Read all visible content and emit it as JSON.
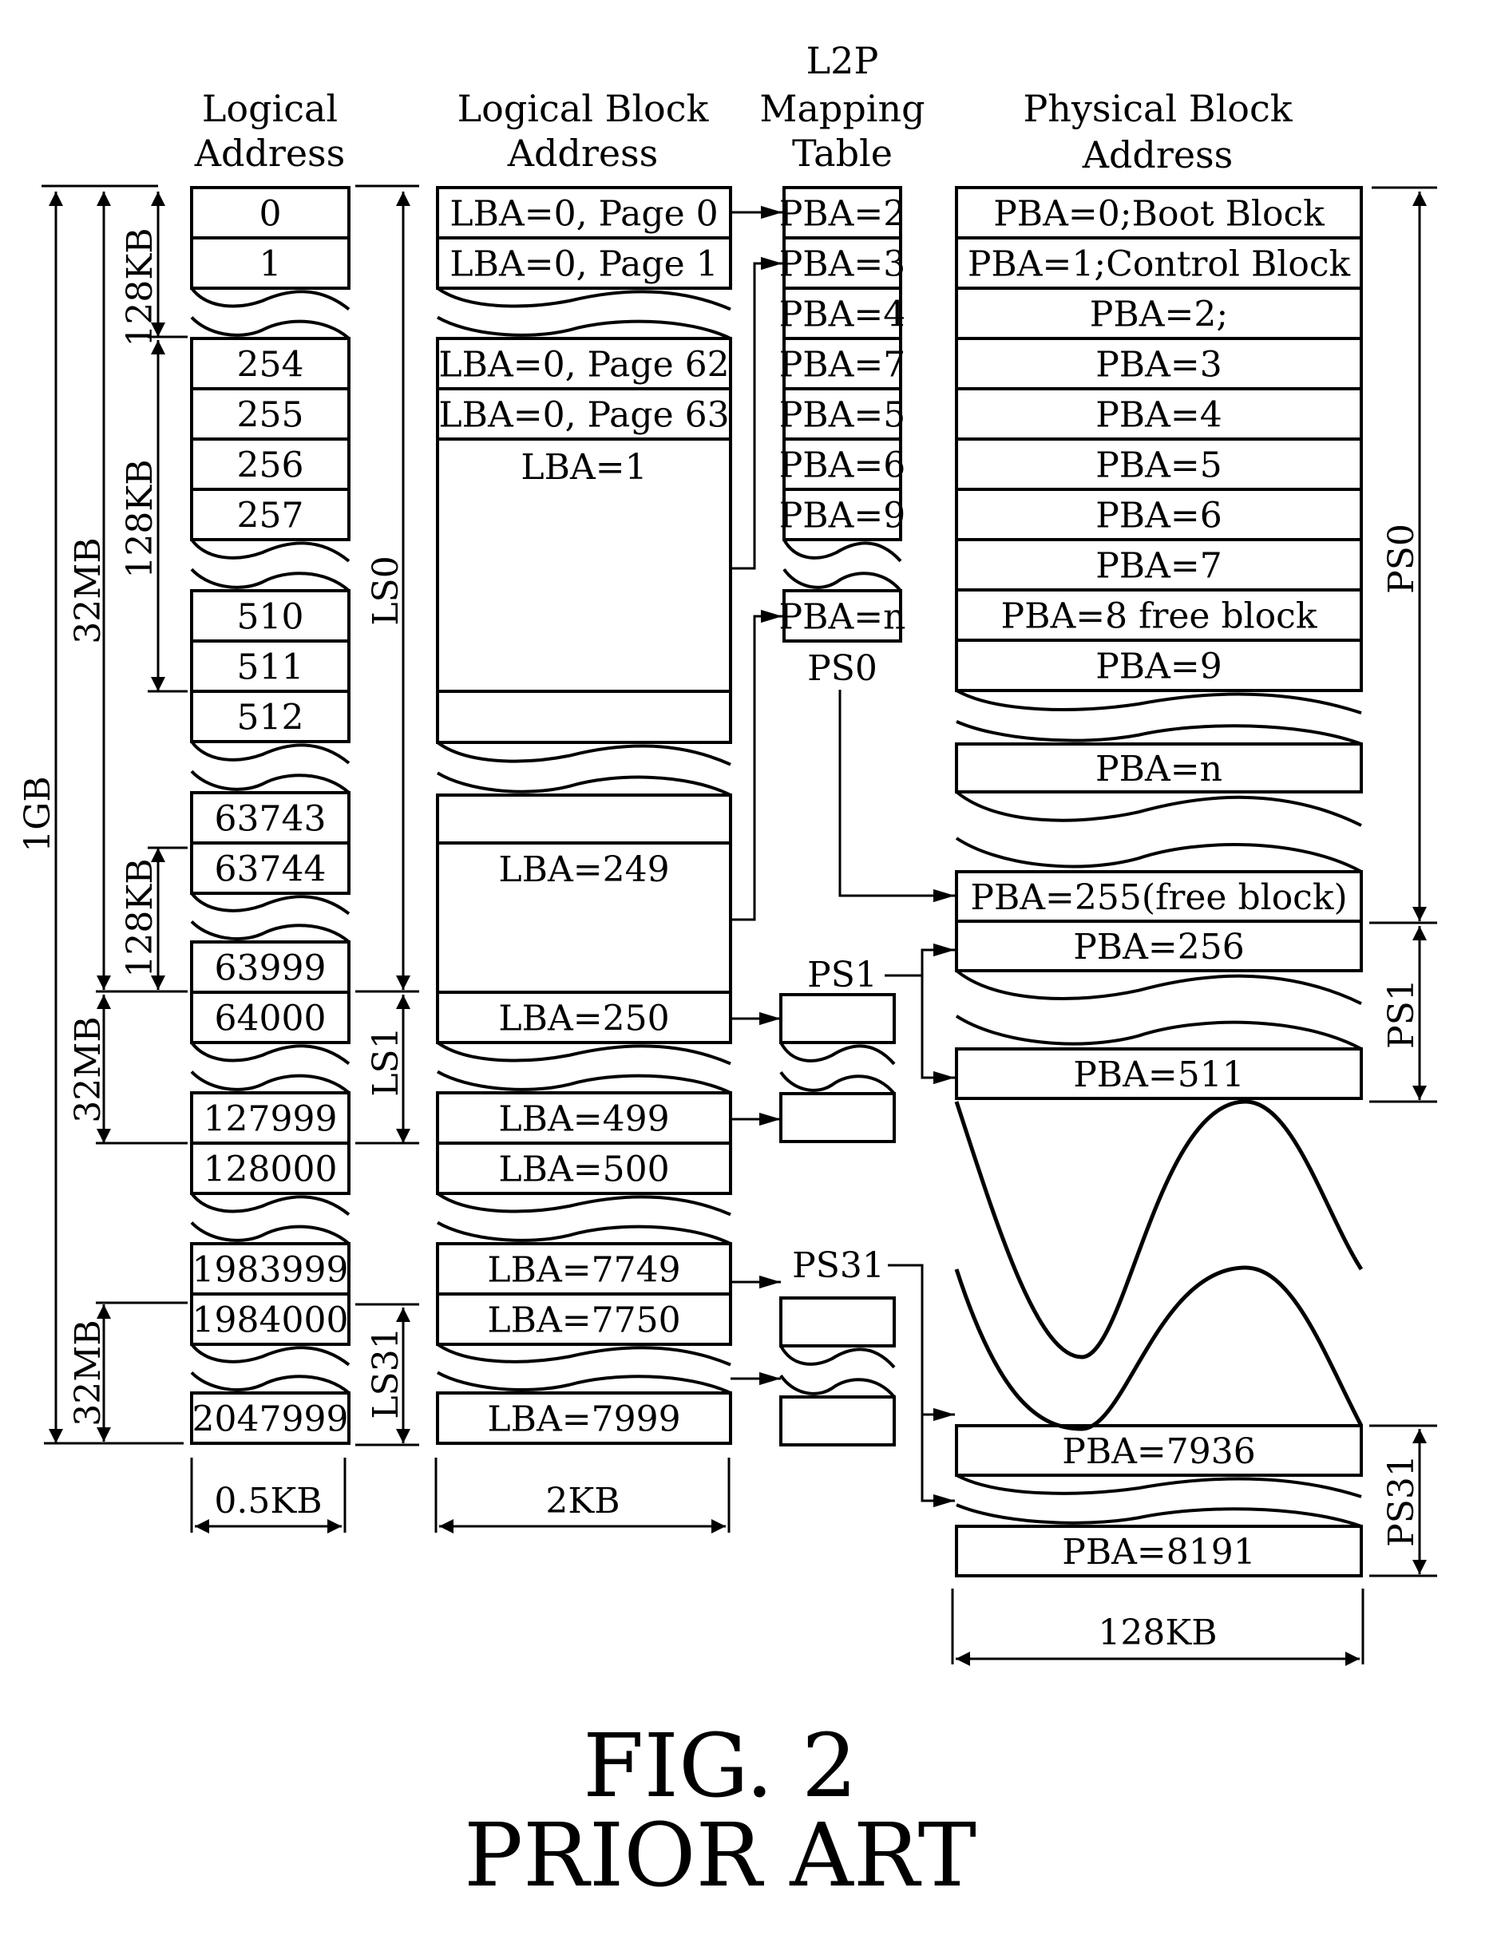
{
  "figure": {
    "title": "FIG. 2",
    "subtitle": "PRIOR ART"
  },
  "headers": {
    "logical_address": [
      "Logical",
      "Address"
    ],
    "logical_block_address": [
      "Logical Block",
      "Address"
    ],
    "l2p_mapping_table": [
      "L2P",
      "Mapping",
      "Table"
    ],
    "physical_block_address": [
      "Physical Block",
      "Address"
    ]
  },
  "logical_address_cells": [
    "0",
    "1",
    "254",
    "255",
    "256",
    "257",
    "510",
    "511",
    "512",
    "63743",
    "63744",
    "63999",
    "64000",
    "127999",
    "128000",
    "1983999",
    "1984000",
    "2047999"
  ],
  "lba_cells": [
    "LBA=0, Page 0",
    "LBA=0, Page 1",
    "LBA=0, Page 62",
    "LBA=0, Page 63",
    "LBA=1",
    "LBA=249",
    "LBA=250",
    "LBA=499",
    "LBA=500",
    "LBA=7749",
    "LBA=7750",
    "LBA=7999"
  ],
  "l2p_cells": [
    "PBA=2",
    "PBA=3",
    "PBA=4",
    "PBA=7",
    "PBA=5",
    "PBA=6",
    "PBA=9",
    "PBA=n"
  ],
  "pba_cells": [
    "PBA=0;Boot Block",
    "PBA=1;Control Block",
    "PBA=2;",
    "PBA=3",
    "PBA=4",
    "PBA=5",
    "PBA=6",
    "PBA=7",
    "PBA=8 free block",
    "PBA=9",
    "PBA=n",
    "PBA=255(free block)",
    "PBA=256",
    "PBA=511",
    "PBA=7936",
    "PBA=8191"
  ],
  "dimension_labels": {
    "total": "1GB",
    "zone_32mb": "32MB",
    "block_128kb": "128KB",
    "sector_width": "0.5KB",
    "page_width": "2KB",
    "block_width": "128KB"
  },
  "segment_labels": {
    "ls0": "LS0",
    "ls1": "LS1",
    "ls31": "LS31",
    "ps0": "PS0",
    "ps1": "PS1",
    "ps31": "PS31"
  },
  "table_labels": {
    "ps0": "PS0",
    "ps1": "PS1",
    "ps31": "PS31"
  }
}
